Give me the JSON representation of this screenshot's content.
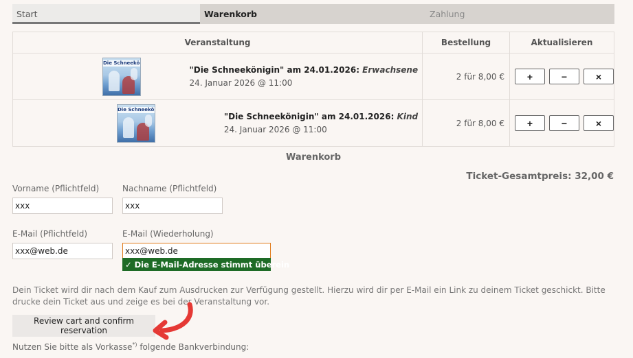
{
  "steps": [
    {
      "label": "Start"
    },
    {
      "label": "Warenkorb"
    },
    {
      "label": "Zahlung"
    }
  ],
  "table": {
    "headers": [
      "Veranstaltung",
      "Bestellung",
      "Aktualisieren"
    ],
    "rows": [
      {
        "poster_title": "Die Schneekönigin",
        "title": "\"Die Schneekönigin\" am 24.01.2026",
        "sep": ": ",
        "category": "Erwachsene",
        "date": "24. Januar 2026 @ 11:00",
        "order": "2 für 8,00 €"
      },
      {
        "poster_title": "Die Schneekönigin",
        "title": "\"Die Schneekönigin\" am 24.01.2026",
        "sep": ": ",
        "category": "Kind",
        "date": "24. Januar 2026 @ 11:00",
        "order": "2 für 8,00 €"
      }
    ],
    "actions": {
      "plus": "+",
      "minus": "−",
      "remove": "×"
    }
  },
  "cart_heading": "Warenkorb",
  "total": "Ticket-Gesamtpreis: 32,00 €",
  "form": {
    "firstname_label": "Vorname (Pflichtfeld)",
    "firstname_value": "xxx",
    "lastname_label": "Nachname (Pflichtfeld)",
    "lastname_value": "xxx",
    "email_label": "E-Mail (Pflichtfeld)",
    "email_value": "xxx@web.de",
    "email_repeat_label": "E-Mail (Wiederholung)",
    "email_repeat_value": "xxx@web.de",
    "match_message": "✓ Die E-Mail-Adresse stimmt überein"
  },
  "info_text": "Dein Ticket wird dir nach dem Kauf zum Ausdrucken zur Verfügung gestellt. Hierzu wird dir per E-Mail ein Link zu deinem Ticket geschickt. Bitte drucke dein Ticket aus und zeige es bei der Veranstaltung vor.",
  "review_button": "Review cart and confirm reservation",
  "bank": {
    "before": "Nutzen Sie bitte als Vorkasse",
    "sup": "*)",
    "after": " folgende Bankverbindung:"
  },
  "colors": {
    "background": "#faf6f3",
    "success": "#1e6b26",
    "focus_border": "#e07a1a",
    "arrow": "#e53935"
  }
}
